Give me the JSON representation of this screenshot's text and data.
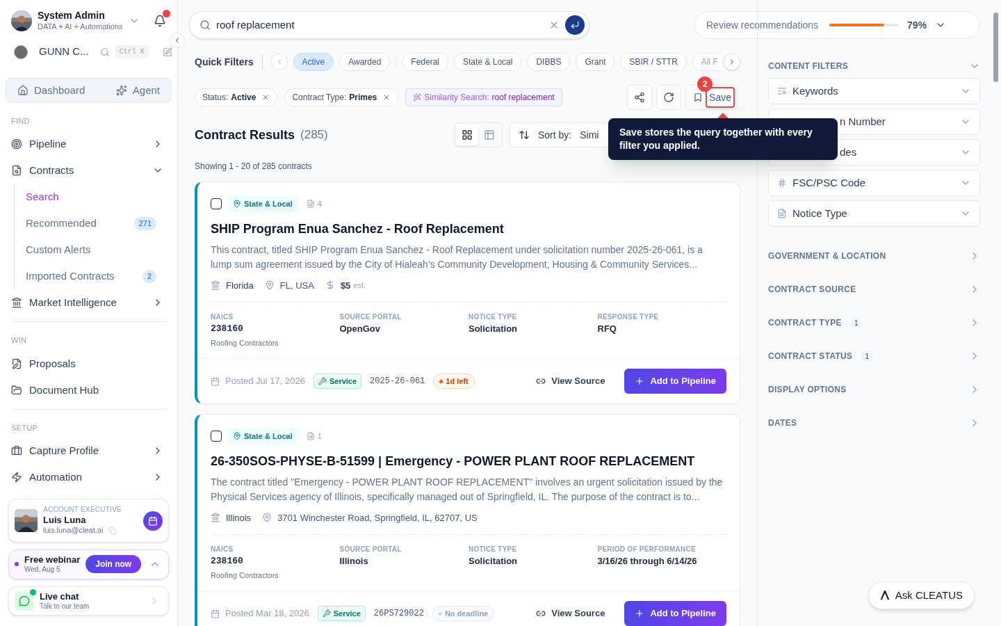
{
  "user": {
    "name": "System Admin",
    "subtitle": "DATA + AI + Automations",
    "notification": true
  },
  "workspace": {
    "name": "GUNN C...",
    "shortcut": "Ctrl K"
  },
  "top_nav": [
    {
      "label": "Dashboard"
    },
    {
      "label": "Agent"
    }
  ],
  "sidebar": {
    "sections": [
      {
        "title": "FIND",
        "items": [
          {
            "label": "Pipeline",
            "expanded": false
          },
          {
            "label": "Contracts",
            "expanded": true,
            "children": [
              {
                "label": "Search",
                "selected": true
              },
              {
                "label": "Recommended",
                "selected": false,
                "badge": "271"
              },
              {
                "label": "Custom Alerts",
                "selected": false
              },
              {
                "label": "Imported Contracts",
                "selected": false,
                "badge": "2"
              }
            ]
          },
          {
            "label": "Market Intelligence",
            "expanded": false
          }
        ]
      },
      {
        "title": "WIN",
        "items": [
          {
            "label": "Proposals"
          },
          {
            "label": "Document Hub"
          }
        ]
      },
      {
        "title": "SETUP",
        "items": [
          {
            "label": "Capture Profile",
            "expanded": false
          },
          {
            "label": "Automation",
            "expanded": false
          }
        ]
      }
    ]
  },
  "account_executive": {
    "role": "ACCOUNT EXECUTIVE",
    "name": "Luis Luna",
    "email": "luis.luna@cleat.ai"
  },
  "webinar": {
    "title": "Free webinar",
    "date": "Wed, Aug 5",
    "button": "Join now"
  },
  "live_chat": {
    "title": "Live chat",
    "subtitle": "Talk to our team",
    "online": true
  },
  "search": {
    "value": "roof replacement"
  },
  "review": {
    "label": "Review recommendations",
    "level": 0.79,
    "reading": "79%"
  },
  "quick_filters": {
    "title": "Quick Filters",
    "chips": [
      {
        "label": "Active",
        "selected": true
      },
      {
        "label": "Awarded",
        "selected": false
      },
      {
        "kind": "divider"
      },
      {
        "label": "Federal",
        "selected": false
      },
      {
        "label": "State & Local",
        "selected": false
      },
      {
        "label": "DIBBS",
        "selected": false
      },
      {
        "label": "Grant",
        "selected": false
      },
      {
        "label": "SBIR / STTR",
        "selected": false
      },
      {
        "label": "All F",
        "selected": false
      }
    ]
  },
  "active_filters": [
    {
      "kind": "plain",
      "key": "Status:",
      "value": "Active"
    },
    {
      "kind": "plain",
      "key": "Contract Type:",
      "value": "Primes"
    },
    {
      "kind": "similarity",
      "key": "Similarity Search:",
      "value": "roof replacement"
    }
  ],
  "save": {
    "label": "Save",
    "step": "2",
    "tooltip": "Save stores the query together with every filter you applied."
  },
  "results": {
    "title": "Contract Results",
    "count": "(285)",
    "showing": "Showing 1 - 20 of 285 contracts",
    "views": [
      {
        "selected": true
      },
      {
        "selected": false
      }
    ],
    "sort_label": "Sort by:",
    "sort_value": "Simi"
  },
  "contracts": [
    {
      "tag": "State & Local",
      "docs": "4",
      "title": "SHIP Program Enua Sanchez - Roof Replacement",
      "summary": "This contract, titled SHIP Program Enua Sanchez - Roof Replacement under solicitation number 2025-26-061, is a lump sum agreement issued by the City of Hialeah’s Community Development, Housing & Community Services...",
      "agency": "Florida",
      "place": "FL, USA",
      "amount": "$5",
      "amount_note": "est.",
      "meta": [
        {
          "label": "NAICS",
          "value": "238160",
          "note": "Roofing Contractors",
          "kind": "code"
        },
        {
          "label": "SOURCE PORTAL",
          "value": "OpenGov"
        },
        {
          "label": "NOTICE TYPE",
          "value": "Solicitation"
        },
        {
          "label": "RESPONSE TYPE",
          "value": "RFQ"
        }
      ],
      "posted": "Posted Jul 17, 2026",
      "type": "Service",
      "number": "2025-26-061",
      "deadline": {
        "kind": "urgent",
        "label": "1d left"
      },
      "view_source": "View Source",
      "add": "Add to Pipeline",
      "checked": false
    },
    {
      "tag": "State & Local",
      "docs": "1",
      "title": "26-350SOS-PHYSE-B-51599 | Emergency - POWER PLANT ROOF REPLACEMENT",
      "summary": "The contract titled \"Emergency - POWER PLANT ROOF REPLACEMENT\" involves an urgent solicitation issued by the Physical Services agency of Illinois, specifically managed out of Springfield, IL. The purpose of the contract is to...",
      "agency": "Illinois",
      "place": "3701 Winchester Road, Springfield, IL, 62707, US",
      "meta": [
        {
          "label": "NAICS",
          "value": "238160",
          "note": "Roofing Contractors",
          "kind": "code"
        },
        {
          "label": "SOURCE PORTAL",
          "value": "Illinois"
        },
        {
          "label": "NOTICE TYPE",
          "value": "Solicitation"
        },
        {
          "label": "PERIOD OF PERFORMANCE",
          "value": "3/16/26 through 6/14/26"
        }
      ],
      "posted": "Posted Mar 18, 2026",
      "type": "Service",
      "number": "26PS729022",
      "deadline": {
        "kind": "none",
        "label": "No deadline"
      },
      "view_source": "View Source",
      "add": "Add to Pipeline",
      "checked": false
    }
  ],
  "content_filters": {
    "title": "CONTENT FILTERS",
    "fields": [
      {
        "kind": "full",
        "label": "Keywords"
      },
      {
        "kind": "covered",
        "label": "n Number"
      },
      {
        "kind": "covered",
        "label": "des"
      },
      {
        "kind": "full",
        "label": "FSC/PSC Code"
      },
      {
        "kind": "full",
        "label": "Notice Type"
      }
    ]
  },
  "filter_sections": [
    {
      "title": "GOVERNMENT & LOCATION"
    },
    {
      "title": "CONTRACT SOURCE"
    },
    {
      "title": "CONTRACT TYPE",
      "count": "1"
    },
    {
      "title": "CONTRACT STATUS",
      "count": "1"
    },
    {
      "title": "DISPLAY OPTIONS"
    },
    {
      "title": "DATES"
    }
  ],
  "assistant": {
    "label": "Ask CLEATUS"
  }
}
